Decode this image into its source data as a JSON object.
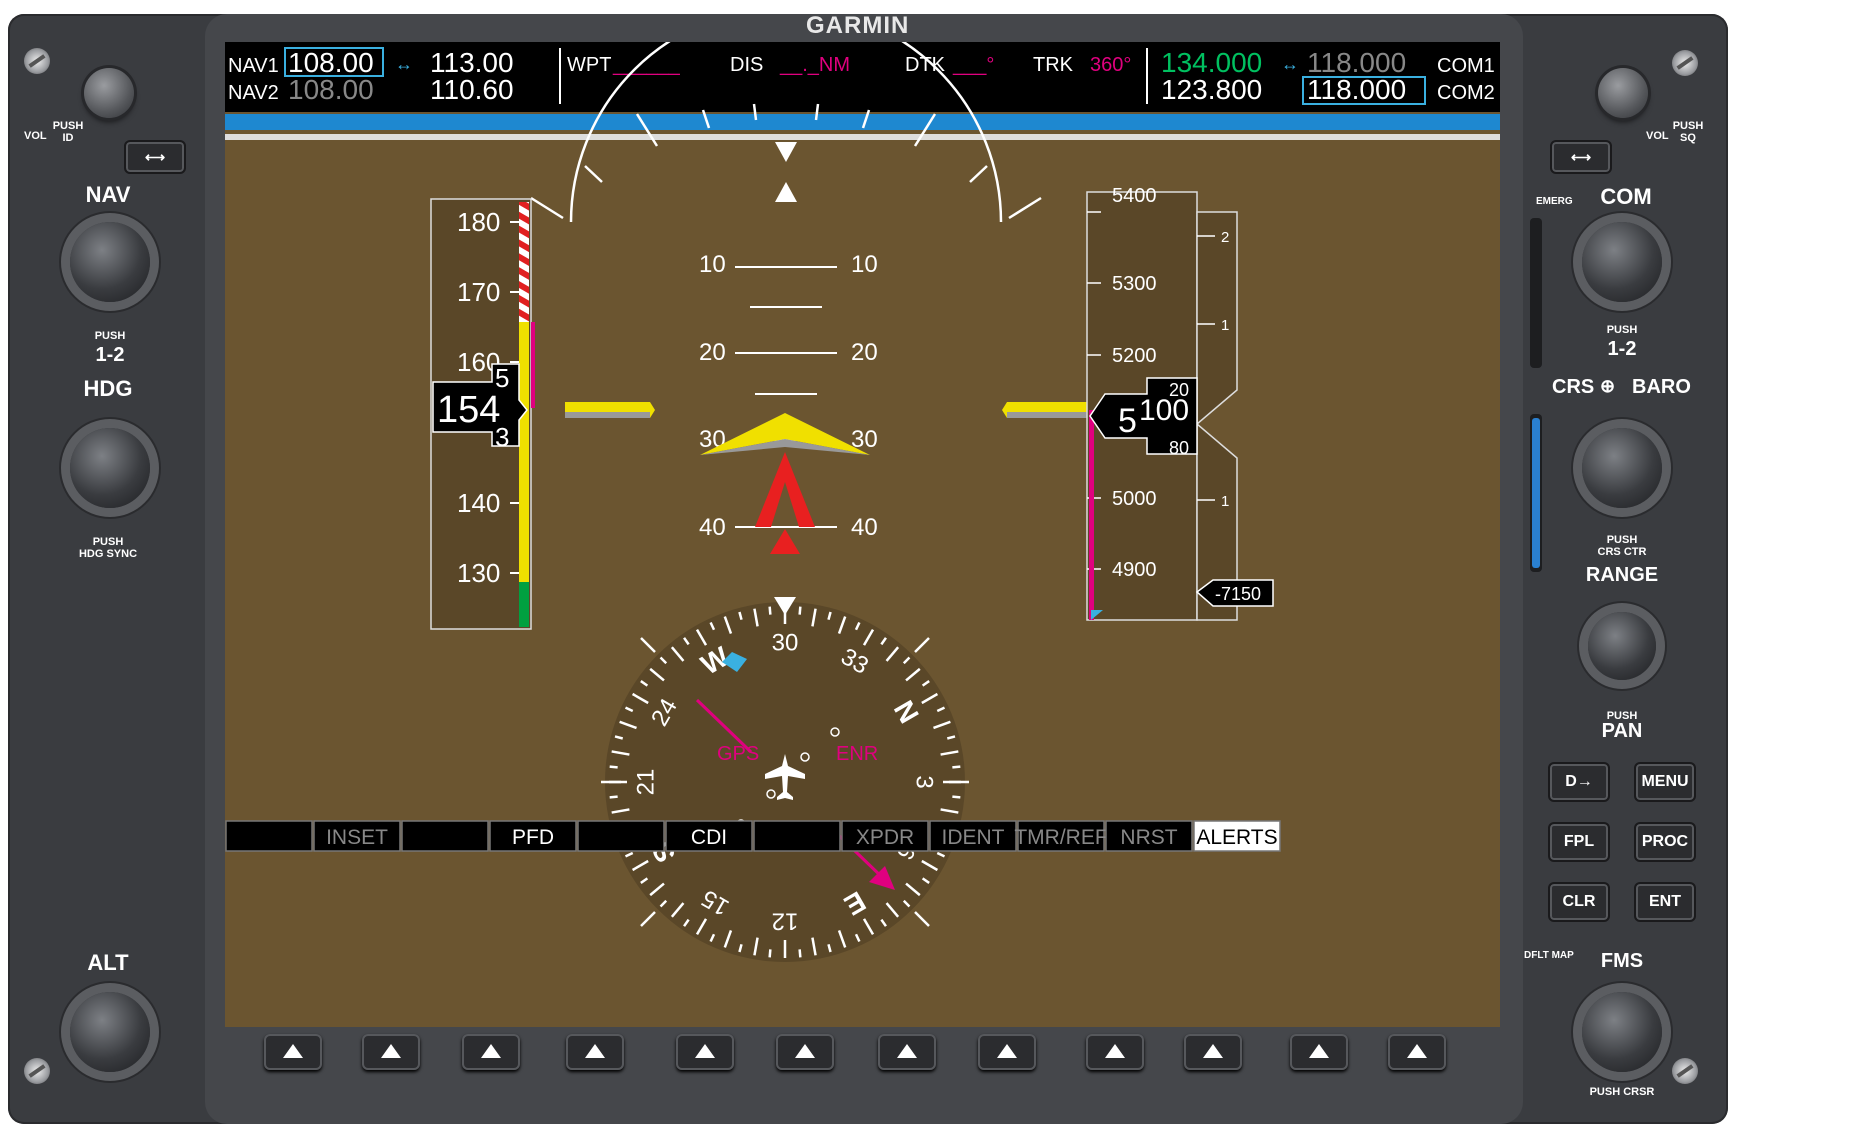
{
  "brand": "GARMIN",
  "left_panel": {
    "vol_label": "VOL",
    "push_id": "PUSH\nID",
    "nav_label": "NAV",
    "push_12": "PUSH",
    "one_two": "1-2",
    "hdg_label": "HDG",
    "push_hdg_sync": "PUSH\nHDG SYNC",
    "alt_label": "ALT"
  },
  "right_panel": {
    "vol_label": "VOL",
    "push_sq": "PUSH\nSQ",
    "emerg": "EMERG",
    "com_label": "COM",
    "push_12": "PUSH",
    "one_two": "1-2",
    "crs_baro": "CRS",
    "baro": "BARO",
    "push_crs_ctr": "PUSH\nCRS CTR",
    "range_label": "RANGE",
    "push_pan": "PUSH",
    "pan": "PAN",
    "buttons": [
      "MENU",
      "FPL",
      "PROC",
      "CLR",
      "ENT"
    ],
    "direct_to": "D→",
    "dflt_map": "DFLT MAP",
    "fms_label": "FMS",
    "push_crsr": "PUSH CRSR"
  },
  "top_bar": {
    "nav1_label": "NAV1",
    "nav1_active": "108.00",
    "nav1_standby": "113.00",
    "nav2_label": "NAV2",
    "nav2_active": "108.00",
    "nav2_standby": "110.60",
    "wpt": "WPT",
    "wpt_value": "______",
    "dis": "DIS",
    "dis_value": "__._NM",
    "dtk": "DTK",
    "dtk_value": "___°",
    "trk": "TRK",
    "trk_value": "360°",
    "com1_active": "134.000",
    "com1_standby": "118.000",
    "com1_label": "COM1",
    "com2_active": "123.800",
    "com2_standby": "118.000",
    "com2_label": "COM2"
  },
  "airspeed": {
    "tape_labels": [
      "180",
      "170",
      "160",
      "140",
      "130"
    ],
    "current": "154",
    "roller_above": "5",
    "roller_below": "3"
  },
  "altimeter": {
    "tape_labels": [
      "5400",
      "5300",
      "5200",
      "5000",
      "4900"
    ],
    "current_hundreds": "5",
    "current_rest": "100",
    "roller_above": "20",
    "roller_below": "80",
    "vsi_labels": [
      "2",
      "1",
      "1"
    ],
    "vs_readout": "-7150"
  },
  "pitch": {
    "ladder_labels": [
      "10",
      "20",
      "30",
      "40"
    ]
  },
  "hsi": {
    "labels": [
      "30",
      "33",
      "N",
      "3",
      "6",
      "E",
      "12",
      "15",
      "S",
      "21",
      "24",
      "W"
    ],
    "gps": "GPS",
    "enr": "ENR"
  },
  "softkeys": [
    "",
    "INSET",
    "",
    "PFD",
    "",
    "CDI",
    "",
    "XPDR",
    "IDENT",
    "TMR/REF",
    "NRST",
    "ALERTS"
  ],
  "colors": {
    "sky_ground": "#6b5530",
    "magenta": "#e0007f",
    "cyan": "#3ab0e0",
    "green": "#00c060",
    "yellow": "#f0e000"
  }
}
